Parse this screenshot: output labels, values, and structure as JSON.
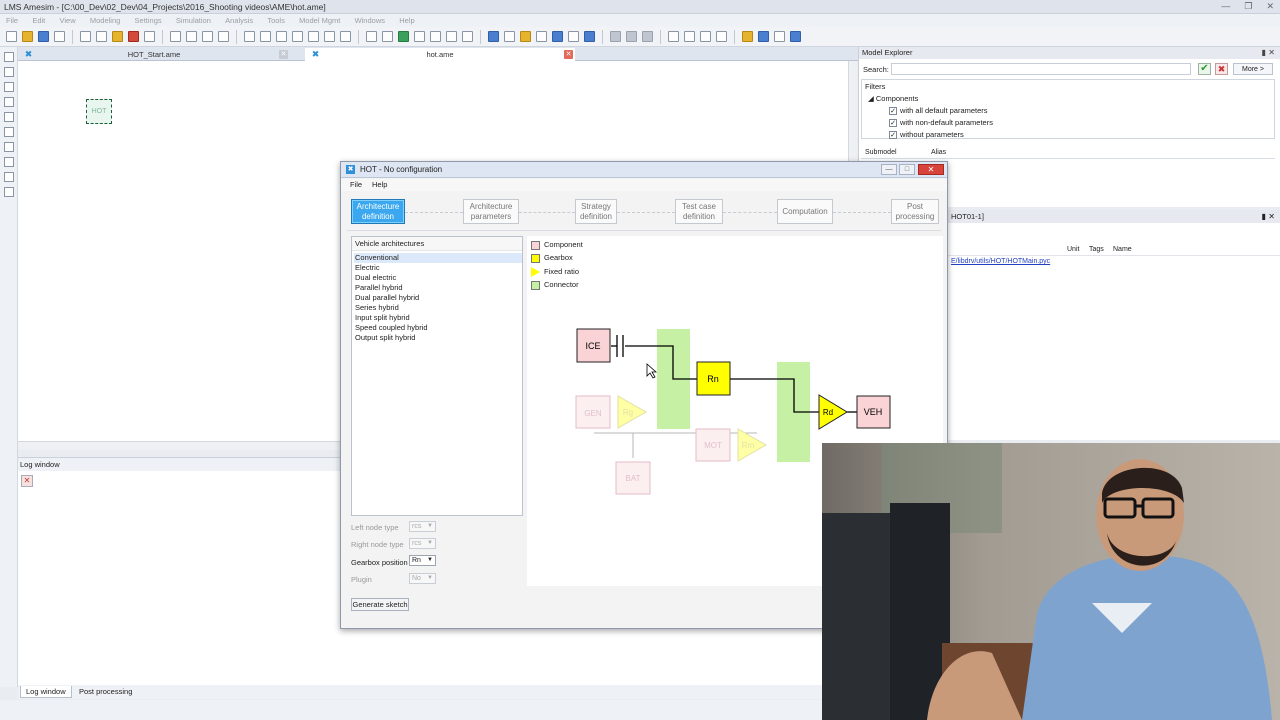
{
  "app": {
    "title": "LMS Amesim - [C:\\00_Dev\\02_Dev\\04_Projects\\2016_Shooting videos\\AME\\hot.ame]"
  },
  "menubar": [
    "File",
    "Edit",
    "View",
    "Modeling",
    "Settings",
    "Simulation",
    "Analysis",
    "Tools",
    "Model Mgmt",
    "Windows",
    "Help"
  ],
  "doc_tabs": [
    {
      "label": "HOT_Start.ame"
    },
    {
      "label": "hot.ame"
    }
  ],
  "canvas": {
    "block_label": "HOT"
  },
  "log_window": {
    "title": "Log window"
  },
  "bottom_tabs": [
    "Log window",
    "Post processing"
  ],
  "model_explorer": {
    "title": "Model Explorer",
    "search_label": "Search:",
    "search_value": "",
    "more_label": "More >",
    "filters_label": "Filters",
    "components_label": "Components",
    "filter_items": [
      {
        "label": "with all default parameters",
        "checked": true
      },
      {
        "label": "with non-default parameters",
        "checked": true
      },
      {
        "label": "without parameters",
        "checked": true
      }
    ],
    "columns": [
      "Submodel",
      "Alias"
    ]
  },
  "right_panel2": {
    "title": "HOT01-1]",
    "columns": [
      "Unit",
      "Tags",
      "Name"
    ],
    "path": "E/libdrv/utils/HOT/HOTMain.pyc"
  },
  "hot_dialog": {
    "title": "HOT - No configuration",
    "menu": [
      "File",
      "Help"
    ],
    "steps": [
      {
        "line1": "Architecture",
        "line2": "definition",
        "active": true
      },
      {
        "line1": "Architecture",
        "line2": "parameters",
        "active": false
      },
      {
        "line1": "Strategy",
        "line2": "definition",
        "active": false
      },
      {
        "line1": "Test case",
        "line2": "definition",
        "active": false
      },
      {
        "line1": "Computation",
        "line2": "",
        "active": false
      },
      {
        "line1": "Post",
        "line2": "processing",
        "active": false
      }
    ],
    "list_header": "Vehicle architectures",
    "architectures": [
      "Conventional",
      "Electric",
      "Dual electric",
      "Parallel hybrid",
      "Dual parallel hybrid",
      "Series hybrid",
      "Input split hybrid",
      "Speed coupled hybrid",
      "Output split hybrid"
    ],
    "selected_architecture": "Conventional",
    "options": [
      {
        "label": "Left node type",
        "value": "rcs",
        "enabled": false
      },
      {
        "label": "Right node type",
        "value": "rcs",
        "enabled": false
      },
      {
        "label": "Gearbox position",
        "value": "Rn",
        "enabled": true
      },
      {
        "label": "Plugin",
        "value": "No",
        "enabled": false
      }
    ],
    "generate_label": "Generate sketch",
    "legend": [
      {
        "label": "Component",
        "color": "#f9d3d6"
      },
      {
        "label": "Gearbox",
        "color": "#ffff00"
      },
      {
        "label": "Fixed ratio",
        "color": "#ffff00"
      },
      {
        "label": "Connector",
        "color": "#c6f0a4"
      }
    ],
    "sketch_labels": {
      "ice": "ICE",
      "rn": "Rn",
      "rd": "Rd",
      "veh": "VEH",
      "gen": "GEN",
      "rg": "Rg",
      "mot": "MOT",
      "rm": "Rm",
      "bat": "BAT"
    }
  },
  "colors": {
    "component": "#f9d3d6",
    "gearbox": "#ffff00",
    "connector": "#c6f0a4",
    "active_step": "#3aa7ee"
  }
}
